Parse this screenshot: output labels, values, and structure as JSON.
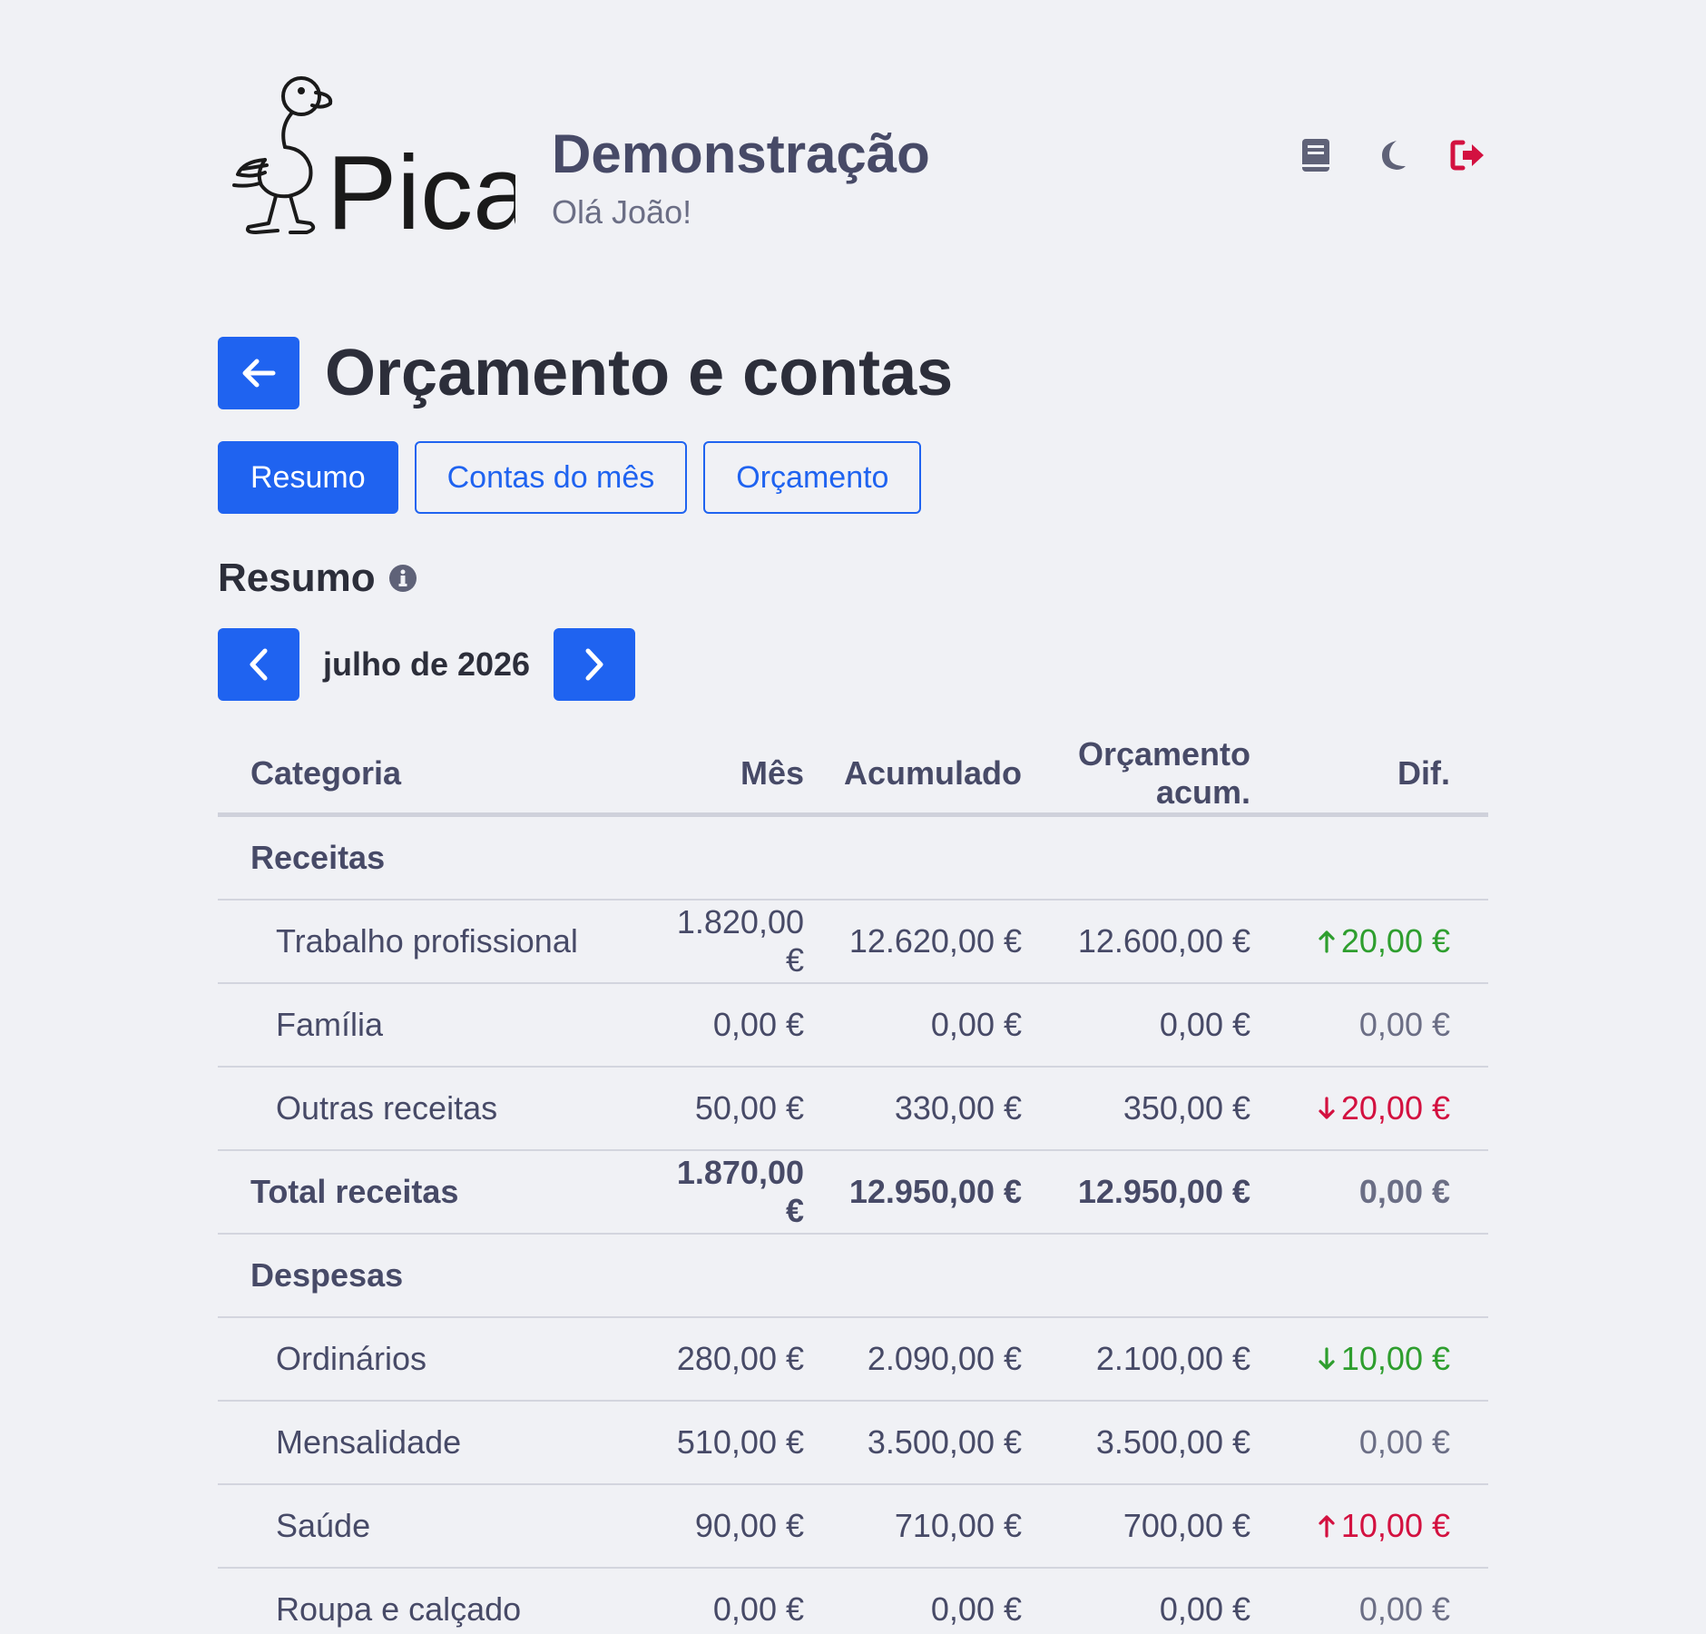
{
  "header": {
    "title": "Demonstração",
    "greeting": "Olá João!",
    "logo_text": "Pica"
  },
  "page": {
    "title": "Orçamento e contas"
  },
  "tabs": [
    {
      "label": "Resumo",
      "active": true
    },
    {
      "label": "Contas do mês",
      "active": false
    },
    {
      "label": "Orçamento",
      "active": false
    }
  ],
  "section": {
    "title": "Resumo"
  },
  "month_nav": {
    "label": "julho de 2026"
  },
  "table": {
    "headers": [
      "Categoria",
      "Mês",
      "Acumulado",
      "Orçamento acum.",
      "Dif."
    ],
    "rows": [
      {
        "kind": "group",
        "cat": "Receitas"
      },
      {
        "kind": "item",
        "cat": "Trabalho profissional",
        "mes": "1.820,00 €",
        "acu": "12.620,00 €",
        "orc": "12.600,00 €",
        "dif": "20,00 €",
        "trend": "up",
        "status": "pos"
      },
      {
        "kind": "item",
        "cat": "Família",
        "mes": "0,00 €",
        "acu": "0,00 €",
        "orc": "0,00 €",
        "dif": "0,00 €",
        "trend": "",
        "status": "zero"
      },
      {
        "kind": "item",
        "cat": "Outras receitas",
        "mes": "50,00 €",
        "acu": "330,00 €",
        "orc": "350,00 €",
        "dif": "20,00 €",
        "trend": "down",
        "status": "neg"
      },
      {
        "kind": "total",
        "cat": "Total receitas",
        "mes": "1.870,00 €",
        "acu": "12.950,00 €",
        "orc": "12.950,00 €",
        "dif": "0,00 €",
        "trend": "",
        "status": "zero"
      },
      {
        "kind": "group",
        "cat": "Despesas"
      },
      {
        "kind": "item",
        "cat": "Ordinários",
        "mes": "280,00 €",
        "acu": "2.090,00 €",
        "orc": "2.100,00 €",
        "dif": "10,00 €",
        "trend": "down",
        "status": "pos"
      },
      {
        "kind": "item",
        "cat": "Mensalidade",
        "mes": "510,00 €",
        "acu": "3.500,00 €",
        "orc": "3.500,00 €",
        "dif": "0,00 €",
        "trend": "",
        "status": "zero"
      },
      {
        "kind": "item",
        "cat": "Saúde",
        "mes": "90,00 €",
        "acu": "710,00 €",
        "orc": "700,00 €",
        "dif": "10,00 €",
        "trend": "up",
        "status": "neg"
      },
      {
        "kind": "item",
        "cat": "Roupa e calçado",
        "mes": "0,00 €",
        "acu": "0,00 €",
        "orc": "0,00 €",
        "dif": "0,00 €",
        "trend": "",
        "status": "zero"
      }
    ]
  },
  "colors": {
    "primary": "#1f63f0",
    "positive": "#2e9e2e",
    "negative": "#d31140",
    "background": "#f0f1f5",
    "logout": "#d31140"
  },
  "icons": {
    "book": "book-icon",
    "theme": "moon-icon",
    "logout": "logout-icon",
    "back": "arrow-left-icon",
    "prev": "chevron-left-icon",
    "next": "chevron-right-icon",
    "info": "info-icon",
    "up": "arrow-up-icon",
    "down": "arrow-down-icon"
  }
}
